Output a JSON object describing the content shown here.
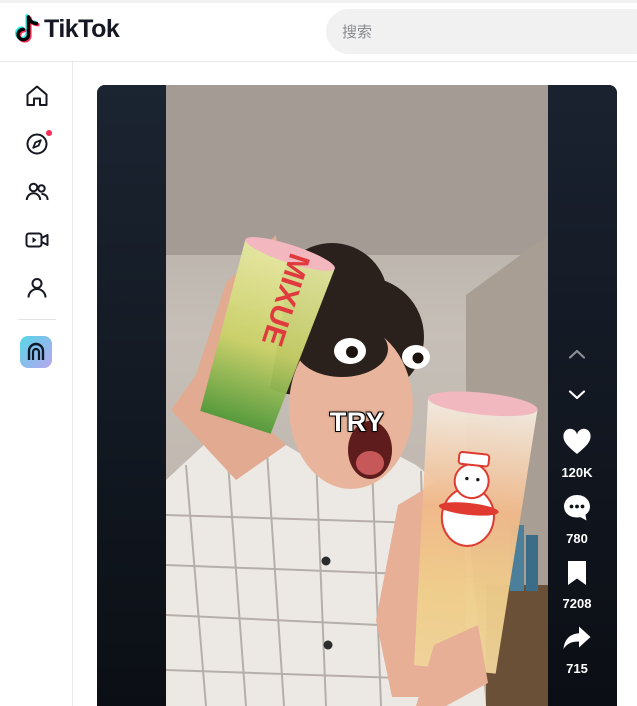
{
  "app": {
    "name": "TikTok",
    "accent": "#fe2c55"
  },
  "search": {
    "placeholder": "搜索"
  },
  "sidebar": {
    "items": [
      {
        "icon": "home-icon"
      },
      {
        "icon": "explore-icon",
        "has_dot": true
      },
      {
        "icon": "following-icon"
      },
      {
        "icon": "live-icon"
      },
      {
        "icon": "profile-icon"
      },
      {
        "icon": "live-badge-icon"
      }
    ]
  },
  "video": {
    "caption": "TRY",
    "stats": {
      "likes": "120K",
      "comments": "780",
      "saves": "7208",
      "shares": "715"
    }
  }
}
